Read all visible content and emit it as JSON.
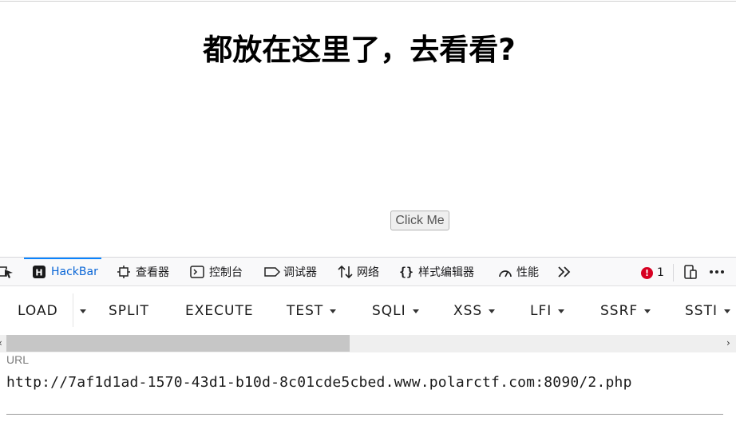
{
  "page": {
    "heading": "都放在这里了，去看看?",
    "button_label": "Click Me"
  },
  "devtools": {
    "tabs": [
      {
        "label": "HackBar",
        "icon": "hackbar-icon",
        "active": true
      },
      {
        "label": "查看器",
        "icon": "inspector-icon"
      },
      {
        "label": "控制台",
        "icon": "console-icon"
      },
      {
        "label": "调试器",
        "icon": "debugger-icon"
      },
      {
        "label": "网络",
        "icon": "network-icon"
      },
      {
        "label": "样式编辑器",
        "icon": "style-editor-icon"
      },
      {
        "label": "性能",
        "icon": "performance-icon"
      }
    ],
    "error_count": "1",
    "accent_color": "#0a84ff",
    "error_color": "#d70022"
  },
  "hackbar": {
    "buttons": {
      "load": "LOAD",
      "split": "SPLIT",
      "execute": "EXECUTE",
      "test": "TEST",
      "sqli": "SQLI",
      "xss": "XSS",
      "lfi": "LFI",
      "ssrf": "SSRF",
      "ssti": "SSTI"
    },
    "url_label": "URL",
    "url_value": "http://7af1d1ad-1570-43d1-b10d-8c01cde5cbed.www.polarctf.com:8090/2.php"
  }
}
